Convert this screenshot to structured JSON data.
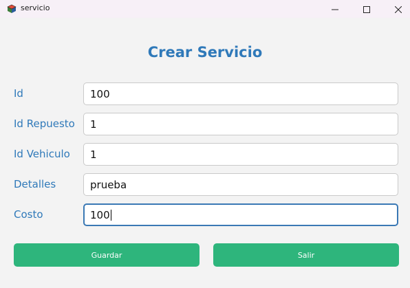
{
  "window": {
    "title": "servicio",
    "icons": {
      "app": "app-cube-icon",
      "minimize": "minimize-icon",
      "maximize": "maximize-icon",
      "close": "close-icon"
    }
  },
  "form": {
    "heading": "Crear Servicio",
    "fields": [
      {
        "label": "Id",
        "value": "100"
      },
      {
        "label": "Id Repuesto",
        "value": "1"
      },
      {
        "label": "Id Vehiculo",
        "value": "1"
      },
      {
        "label": "Detalles",
        "value": "prueba"
      },
      {
        "label": "Costo",
        "value": "100"
      }
    ],
    "focused_field": "Costo"
  },
  "buttons": {
    "save_label": "Guardar",
    "exit_label": "Salir"
  },
  "colors": {
    "accent_text": "#2f79b9",
    "button_bg": "#2eb57c",
    "focus_border": "#3a78b4"
  }
}
